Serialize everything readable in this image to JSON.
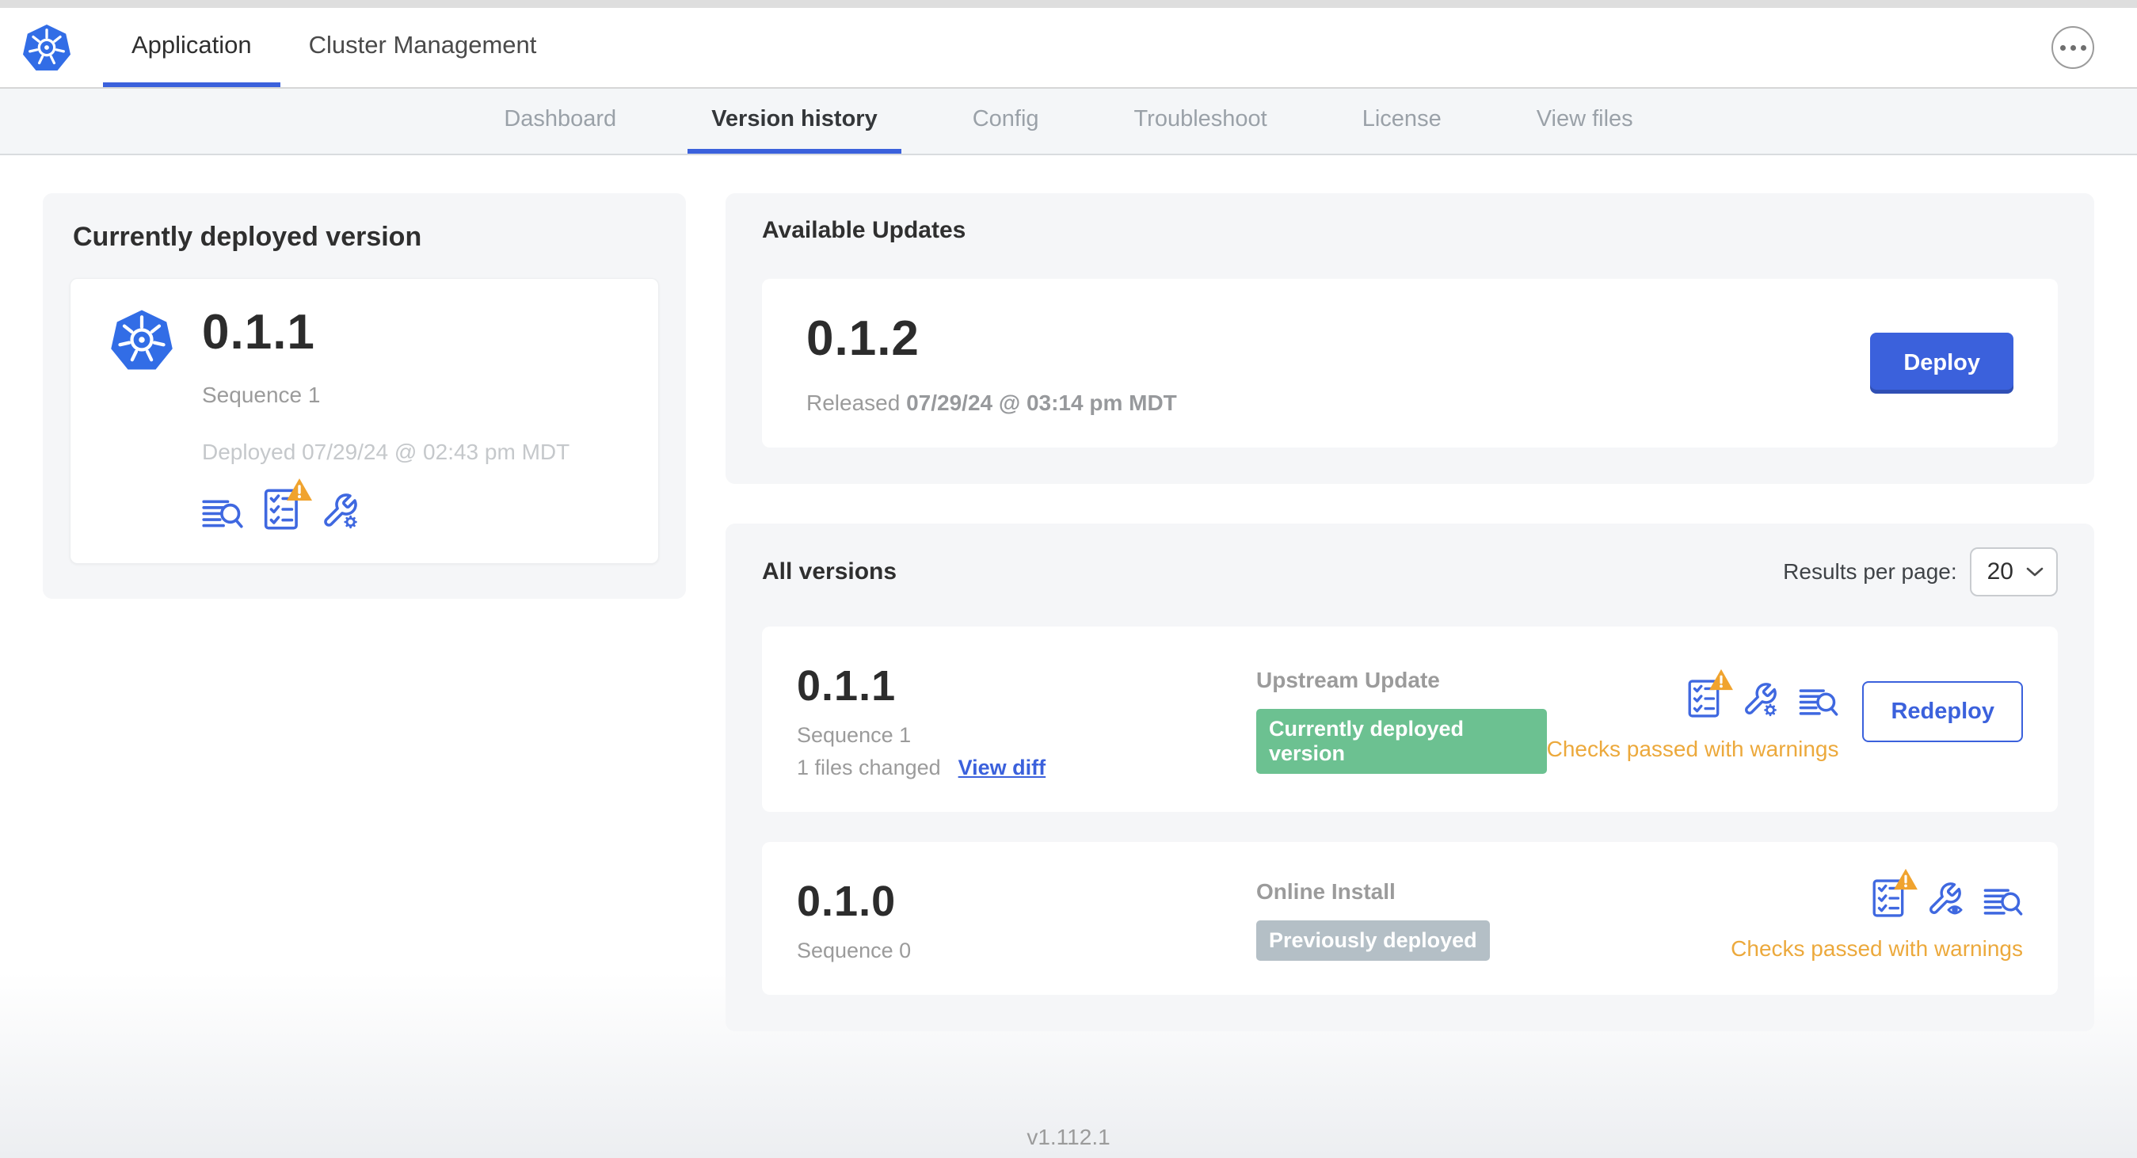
{
  "colors": {
    "accent": "#3b61dc",
    "warning-text": "#eca93c",
    "warning-triangle": "#f0a32e",
    "badge-green": "#6cc191",
    "badge-gray": "#b4bfc6",
    "logo-blue": "#326de6"
  },
  "header": {
    "tabs": [
      {
        "label": "Application"
      },
      {
        "label": "Cluster Management"
      }
    ],
    "more_menu": "ellipsis-menu"
  },
  "subnav": {
    "tabs": [
      {
        "label": "Dashboard"
      },
      {
        "label": "Version history"
      },
      {
        "label": "Config"
      },
      {
        "label": "Troubleshoot"
      },
      {
        "label": "License"
      },
      {
        "label": "View files"
      }
    ],
    "active": "Version history"
  },
  "deployed_card": {
    "title": "Currently deployed version",
    "version": "0.1.1",
    "sequence": "Sequence 1",
    "deployed": "Deployed 07/29/24 @ 02:43 pm MDT",
    "icons": [
      "diff-lines-magnifier-icon",
      "preflight-checklist-warning-icon",
      "config-wrench-gear-icon"
    ]
  },
  "available_updates": {
    "title": "Available Updates",
    "version": "0.1.2",
    "released_label": "Released",
    "released_date": "07/29/24 @ 03:14 pm MDT",
    "deploy_label": "Deploy"
  },
  "all_versions": {
    "title": "All versions",
    "results_per_page_label": "Results per page:",
    "results_per_page_value": "20",
    "rows": [
      {
        "version": "0.1.1",
        "sequence": "Sequence 1",
        "files_changed": "1 files changed",
        "view_diff_label": "View diff",
        "source": "Upstream Update",
        "badge": "Currently deployed version",
        "badge_type": "green",
        "icons": [
          "preflight-checklist-warning-icon",
          "config-wrench-gear-icon",
          "diff-lines-magnifier-icon"
        ],
        "action_label": "Redeploy",
        "status": "Checks passed with warnings"
      },
      {
        "version": "0.1.0",
        "sequence": "Sequence 0",
        "source": "Online Install",
        "badge": "Previously deployed",
        "badge_type": "gray",
        "icons": [
          "preflight-checklist-warning-icon",
          "config-wrench-eye-icon",
          "diff-lines-magnifier-icon"
        ],
        "status": "Checks passed with warnings"
      }
    ]
  },
  "footer": {
    "app_version": "v1.112.1"
  }
}
